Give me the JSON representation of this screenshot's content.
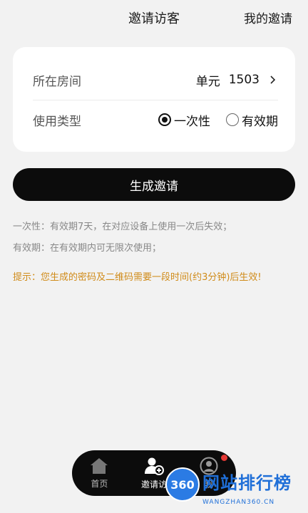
{
  "header": {
    "title": "邀请访客",
    "right_link": "我的邀请"
  },
  "form": {
    "room_label": "所在房间",
    "room_unit": "单元",
    "room_number": "1503",
    "type_label": "使用类型",
    "type_options": [
      {
        "label": "一次性",
        "selected": true
      },
      {
        "label": "有效期",
        "selected": false
      }
    ]
  },
  "generate_button": "生成邀请",
  "notes": [
    "一次性：有效期7天，在对应设备上使用一次后失效；",
    "有效期：在有效期内可无限次使用；"
  ],
  "tip": "提示：您生成的密码及二维码需要一段时间(约3分钟)后生效!",
  "tabbar": {
    "items": [
      {
        "label": "首页",
        "icon": "home-icon",
        "active": false
      },
      {
        "label": "邀请访",
        "icon": "invite-visitor-icon",
        "active": true
      },
      {
        "label": "我",
        "icon": "user-icon",
        "active": false,
        "badge": true
      }
    ]
  },
  "watermark": {
    "logo": "360",
    "title": "网站排行榜",
    "subtitle": "WANGZHAN360.CN"
  },
  "colors": {
    "accent": "#0c0c0c",
    "tip": "#d08b19",
    "badge": "#e53935",
    "watermark": "#1f6fd8"
  }
}
